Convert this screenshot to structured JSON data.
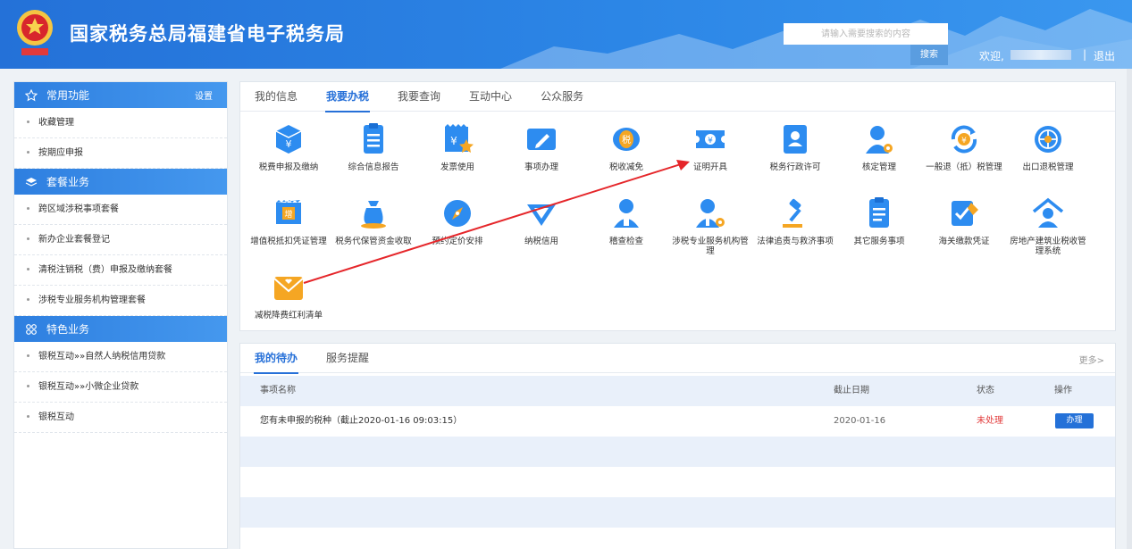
{
  "header": {
    "title": "国家税务总局福建省电子税务局",
    "search_placeholder": "请输入需要搜索的内容",
    "search_button": "搜索",
    "welcome": "欢迎,",
    "separator": "|",
    "logout": "退出",
    "colors": {
      "bg": "#2a7ee2",
      "accent": "#2670d8"
    }
  },
  "sidebar": {
    "sections": [
      {
        "title": "常用功能",
        "icon": "star-icon",
        "action": "设置",
        "items": [
          "收藏管理",
          "按期应申报"
        ]
      },
      {
        "title": "套餐业务",
        "icon": "layers-icon",
        "items": [
          "跨区域涉税事项套餐",
          "新办企业套餐登记",
          "清税注销税（费）申报及缴纳套餐",
          "涉税专业服务机构管理套餐"
        ]
      },
      {
        "title": "特色业务",
        "icon": "grid-icon",
        "items": [
          "银税互动»»自然人纳税信用贷款",
          "银税互动»»小微企业贷款",
          "银税互动"
        ]
      }
    ]
  },
  "main": {
    "tabs": [
      "我的信息",
      "我要办税",
      "我要查询",
      "互动中心",
      "公众服务"
    ],
    "active_tab": "我要办税",
    "services": [
      {
        "label": "税费申报及缴纳",
        "icon": "tax-declare-icon"
      },
      {
        "label": "综合信息报告",
        "icon": "document-report-icon"
      },
      {
        "label": "发票使用",
        "icon": "invoice-icon"
      },
      {
        "label": "事项办理",
        "icon": "edit-matter-icon"
      },
      {
        "label": "税收减免",
        "icon": "tax-reduction-icon"
      },
      {
        "label": "证明开具",
        "icon": "certificate-ticket-icon"
      },
      {
        "label": "税务行政许可",
        "icon": "permit-card-icon"
      },
      {
        "label": "核定管理",
        "icon": "user-gear-icon"
      },
      {
        "label": "一般退（抵）税管理",
        "icon": "refund-cycle-icon"
      },
      {
        "label": "出口退税管理",
        "icon": "globe-export-icon"
      },
      {
        "label": "增值税抵扣凭证管理",
        "icon": "vat-deduction-icon"
      },
      {
        "label": "税务代保管资金收取",
        "icon": "money-bag-icon"
      },
      {
        "label": "预约定价安排",
        "icon": "compass-icon"
      },
      {
        "label": "纳税信用",
        "icon": "credit-shield-icon"
      },
      {
        "label": "稽查检查",
        "icon": "inspector-icon"
      },
      {
        "label": "涉税专业服务机构管理",
        "icon": "agency-user-icon"
      },
      {
        "label": "法律追责与救济事项",
        "icon": "gavel-icon"
      },
      {
        "label": "其它服务事项",
        "icon": "list-doc-icon"
      },
      {
        "label": "海关缴款凭证",
        "icon": "customs-check-icon"
      },
      {
        "label": "房地产建筑业税收管理系统",
        "icon": "house-user-icon"
      },
      {
        "label": "减税降费红利清单",
        "icon": "mail-heart-icon"
      }
    ]
  },
  "todo": {
    "tabs": [
      "我的待办",
      "服务提醒"
    ],
    "more": "更多>",
    "columns": [
      "事项名称",
      "截止日期",
      "状态",
      "操作"
    ],
    "rows": [
      {
        "name": "您有未申报的税种（截止2020-01-16 09:03:15）",
        "deadline": "2020-01-16",
        "status": "未处理",
        "action": "办理"
      }
    ]
  }
}
